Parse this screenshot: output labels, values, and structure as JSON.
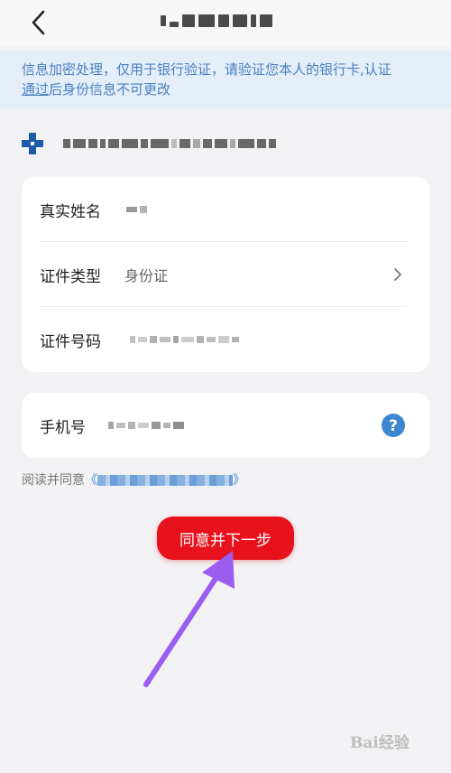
{
  "notice": {
    "line1": "信息加密处理，仅用于银行验证，请验证您本人的银行卡,认证",
    "line2_link": "通过",
    "line2_rest": "后身份信息不可更改"
  },
  "identity_form": {
    "real_name_label": "真实姓名",
    "id_type_label": "证件类型",
    "id_type_value": "身份证",
    "id_number_label": "证件号码"
  },
  "phone_form": {
    "phone_label": "手机号"
  },
  "agreement": {
    "prefix": "阅读并同意"
  },
  "next_button": {
    "label": "同意并下一步"
  },
  "colors": {
    "accent_red": "#e8121e",
    "notice_blue": "#4a7fc0",
    "help_blue": "#3e86cf",
    "annotation_purple": "#9b5cf0"
  },
  "watermark": {
    "text": "Bai经验"
  }
}
